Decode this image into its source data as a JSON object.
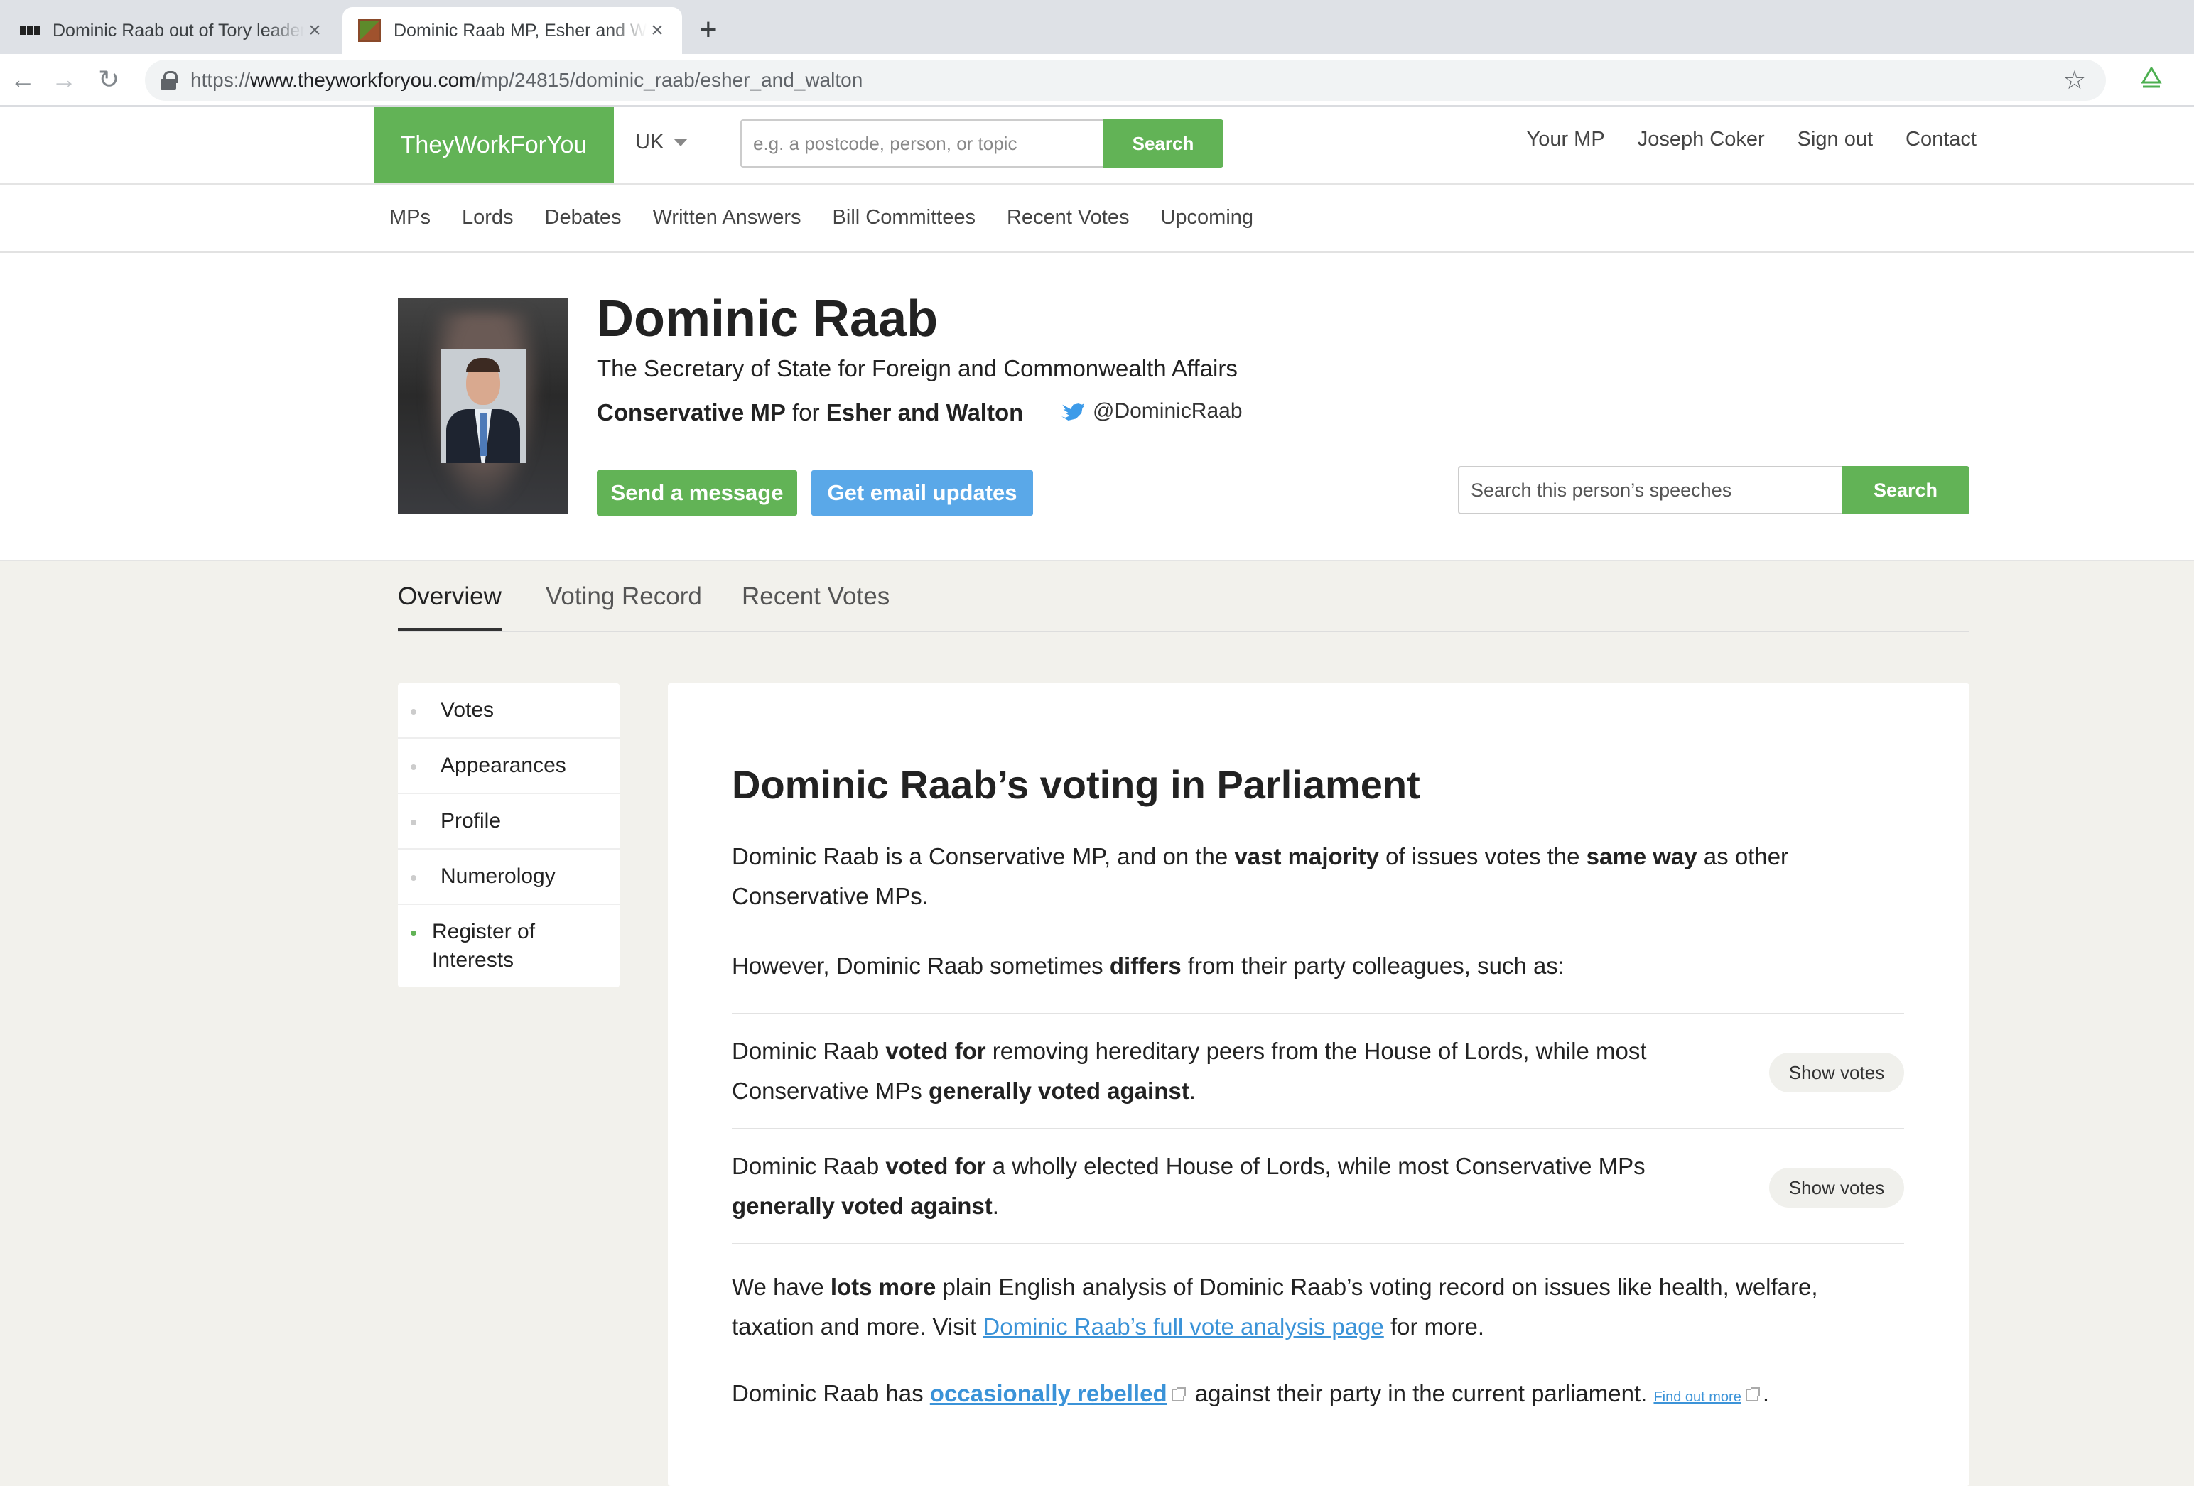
{
  "browser": {
    "tabs": [
      {
        "title": "Dominic Raab out of Tory leadership race",
        "active": false
      },
      {
        "title": "Dominic Raab MP, Esher and Walton",
        "active": true
      }
    ],
    "url_scheme": "https://",
    "url_host": "www.theyworkforyou.com",
    "url_path": "/mp/24815/dominic_raab/esher_and_walton"
  },
  "header": {
    "logo": "TheyWorkForYou",
    "country": "UK",
    "search_placeholder": "e.g. a postcode, person, or topic",
    "search_button": "Search",
    "links": [
      "Your MP",
      "Joseph Coker",
      "Sign out",
      "Contact"
    ]
  },
  "subnav": [
    "MPs",
    "Lords",
    "Debates",
    "Written Answers",
    "Bill Committees",
    "Recent Votes",
    "Upcoming"
  ],
  "person": {
    "name": "Dominic Raab",
    "office": "The Secretary of State for Foreign and Commonwealth Affairs",
    "party_role": "Conservative MP",
    "for_word": "for",
    "constituency": "Esher and Walton",
    "twitter": "@DominicRaab",
    "send_message": "Send a message",
    "email_updates": "Get email updates",
    "speech_search_placeholder": "Search this person’s speeches",
    "speech_search_button": "Search"
  },
  "page_tabs": [
    "Overview",
    "Voting Record",
    "Recent Votes"
  ],
  "sidebar": [
    "Votes",
    "Appearances",
    "Profile",
    "Numerology",
    "Register of Interests"
  ],
  "main": {
    "heading": "Dominic Raab’s voting in Parliament",
    "p1": {
      "a": "Dominic Raab is a Conservative MP, and on the ",
      "b1": "vast majority",
      "c": " of issues votes the ",
      "b2": "same way",
      "d": " as other Conservative MPs."
    },
    "p2": {
      "a": "However, Dominic Raab sometimes ",
      "b": "differs",
      "c": " from their party colleagues, such as:"
    },
    "votes": [
      {
        "a": "Dominic Raab ",
        "b1": "voted for",
        "c": " removing hereditary peers from the House of Lords, while most Conservative MPs ",
        "b2": "generally voted against",
        "d": ".",
        "button": "Show votes"
      },
      {
        "a": "Dominic Raab ",
        "b1": "voted for",
        "c": " a wholly elected House of Lords, while most Conservative MPs ",
        "b2": "generally voted against",
        "d": ".",
        "button": "Show votes"
      }
    ],
    "p3": {
      "a": "We have ",
      "b": "lots more",
      "c": " plain English analysis of Dominic Raab’s voting record on issues like health, welfare, taxation and more. Visit ",
      "link": "Dominic Raab’s full vote analysis page",
      "d": " for more."
    },
    "p4": {
      "a": "Dominic Raab has ",
      "link": "occasionally rebelled",
      "c": " against their party in the current parliament. ",
      "small_link": "Find out more",
      "d": "."
    }
  }
}
